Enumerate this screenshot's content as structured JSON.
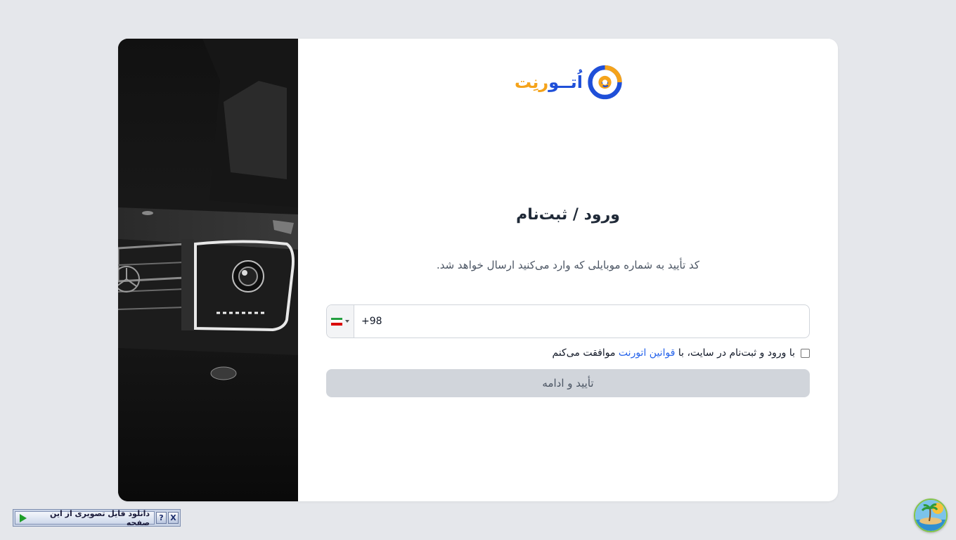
{
  "logo": {
    "word_blue": "اُتــو",
    "word_orange": "رنِت"
  },
  "auth": {
    "title": "ورود / ثبت‌نام",
    "description": "کد تأیید به شماره موبایلی که وارد می‌کنید ارسال خواهد شد.",
    "phone": {
      "value": "+98"
    },
    "terms": {
      "before": "با ورود و ثبت‌نام در سایت، با",
      "link": "قوانین اتورنت",
      "after": "موافقت می‌کنم",
      "checked": false
    },
    "submit_label": "تأیید و ادامه"
  },
  "download_bar": {
    "label": "دانلود فایل تصویری از این صفحه",
    "help": "?",
    "close": "X"
  },
  "colors": {
    "background": "#e5e7eb",
    "brand_blue": "#1f4fd8",
    "brand_orange": "#f5a31a",
    "link": "#2563eb",
    "button_disabled": "#d1d5db"
  },
  "icons": [
    "car-photo",
    "brand-logo-icon",
    "iran-flag-icon",
    "caret-down-icon",
    "play-icon",
    "help-icon",
    "close-icon",
    "island-icon"
  ]
}
